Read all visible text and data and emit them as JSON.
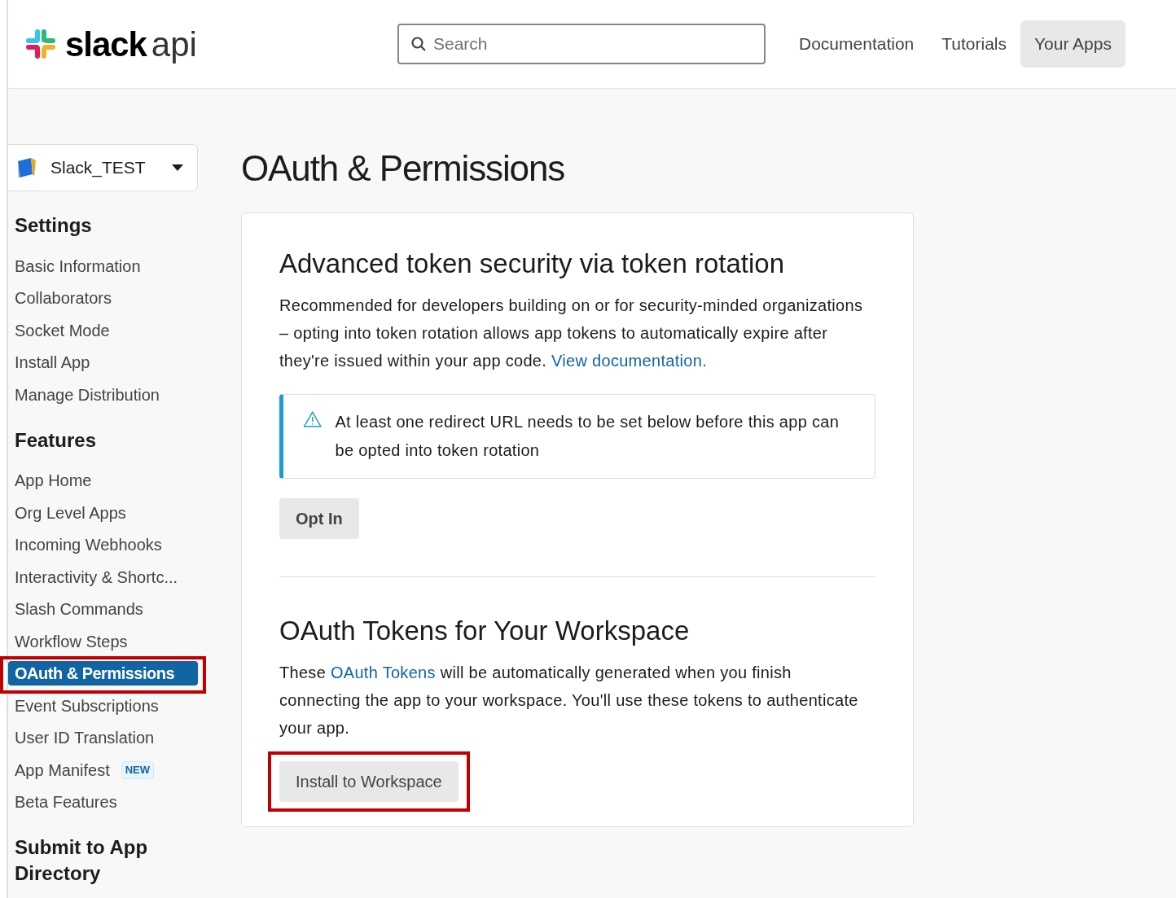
{
  "header": {
    "logo_text": "slack",
    "logo_suffix": "api",
    "search": {
      "placeholder": "Search"
    },
    "nav": [
      {
        "label": "Documentation",
        "selected": false
      },
      {
        "label": "Tutorials",
        "selected": false
      },
      {
        "label": "Your Apps",
        "selected": true
      }
    ]
  },
  "sidebar": {
    "app_selector": {
      "name": "Slack_TEST"
    },
    "sections": [
      {
        "heading": "Settings",
        "items": [
          {
            "label": "Basic Information",
            "selected": false,
            "highlighted": false
          },
          {
            "label": "Collaborators",
            "selected": false,
            "highlighted": false
          },
          {
            "label": "Socket Mode",
            "selected": false,
            "highlighted": false
          },
          {
            "label": "Install App",
            "selected": false,
            "highlighted": false
          },
          {
            "label": "Manage Distribution",
            "selected": false,
            "highlighted": false
          }
        ]
      },
      {
        "heading": "Features",
        "items": [
          {
            "label": "App Home",
            "selected": false,
            "highlighted": false
          },
          {
            "label": "Org Level Apps",
            "selected": false,
            "highlighted": false
          },
          {
            "label": "Incoming Webhooks",
            "selected": false,
            "highlighted": false
          },
          {
            "label": "Interactivity & Shortc...",
            "selected": false,
            "highlighted": false
          },
          {
            "label": "Slash Commands",
            "selected": false,
            "highlighted": false
          },
          {
            "label": "Workflow Steps",
            "selected": false,
            "highlighted": false
          },
          {
            "label": "OAuth & Permissions",
            "selected": true,
            "highlighted": true
          },
          {
            "label": "Event Subscriptions",
            "selected": false,
            "highlighted": false
          },
          {
            "label": "User ID Translation",
            "selected": false,
            "highlighted": false
          },
          {
            "label": "App Manifest",
            "badge": "NEW",
            "selected": false,
            "highlighted": false
          },
          {
            "label": "Beta Features",
            "selected": false,
            "highlighted": false
          }
        ]
      },
      {
        "heading": "Submit to App Directory"
      }
    ]
  },
  "page_title": "OAuth & Permissions",
  "card": {
    "sections": [
      {
        "title": "Advanced token security via token rotation",
        "text": [
          {
            "text": "Recommended for developers building on or for security-minded organizations – opting into token rotation allows app tokens to automatically expire after they're issued within your app code. "
          },
          {
            "text": "View documentation.",
            "link": true
          }
        ],
        "alert": {
          "text": "At least one redirect URL needs to be set below before this app can be opted into token rotation"
        },
        "button": {
          "label": "Opt In",
          "highlighted": false
        }
      },
      {
        "title": "OAuth Tokens for Your Workspace",
        "text": [
          {
            "text": "These "
          },
          {
            "text": "OAuth Tokens",
            "link": true
          },
          {
            "text": " will be automatically generated when you finish connecting the app to your workspace. You'll use these tokens to authenticate your app."
          }
        ],
        "button": {
          "label": "Install to Workspace",
          "highlighted": true
        }
      }
    ]
  }
}
